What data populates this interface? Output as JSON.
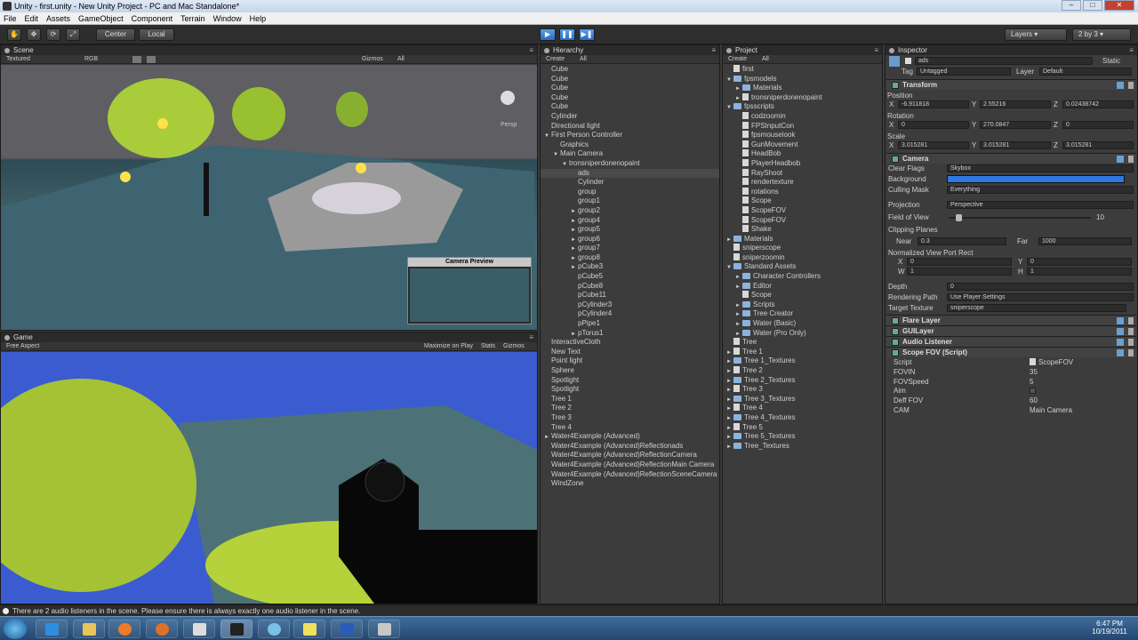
{
  "window": {
    "title": "Unity - first.unity - New Unity Project - PC and Mac Standalone*"
  },
  "menu": [
    "File",
    "Edit",
    "Assets",
    "GameObject",
    "Component",
    "Terrain",
    "Window",
    "Help"
  ],
  "toolbar": {
    "center": "Center",
    "local": "Local",
    "layers": "Layers",
    "layout": "2 by 3"
  },
  "scene": {
    "tab": "Scene",
    "render_mode": "Textured",
    "color_mode": "RGB",
    "gizmos": "Gizmos",
    "search": "All",
    "persp": "Persp",
    "camera_preview": "Camera Preview"
  },
  "game": {
    "tab": "Game",
    "aspect": "Free Aspect",
    "maximize": "Maximize on Play",
    "stats": "Stats",
    "gizmos": "Gizmos"
  },
  "hierarchy": {
    "tab": "Hierarchy",
    "create": "Create",
    "search": "All",
    "items": [
      {
        "label": "Cube",
        "indent": 0,
        "arrow": ""
      },
      {
        "label": "Cube",
        "indent": 0,
        "arrow": ""
      },
      {
        "label": "Cube",
        "indent": 0,
        "arrow": ""
      },
      {
        "label": "Cube",
        "indent": 0,
        "arrow": ""
      },
      {
        "label": "Cube",
        "indent": 0,
        "arrow": ""
      },
      {
        "label": "Cylinder",
        "indent": 0,
        "arrow": ""
      },
      {
        "label": "Directional light",
        "indent": 0,
        "arrow": ""
      },
      {
        "label": "First Person Controller",
        "indent": 0,
        "arrow": "▼"
      },
      {
        "label": "Graphics",
        "indent": 1,
        "arrow": ""
      },
      {
        "label": "Main Camera",
        "indent": 1,
        "arrow": "▼"
      },
      {
        "label": "tronsniperdonenopaint",
        "indent": 2,
        "arrow": "▼"
      },
      {
        "label": "ads",
        "indent": 3,
        "arrow": "",
        "sel": true
      },
      {
        "label": "Cylinder",
        "indent": 3,
        "arrow": ""
      },
      {
        "label": "group",
        "indent": 3,
        "arrow": ""
      },
      {
        "label": "group1",
        "indent": 3,
        "arrow": ""
      },
      {
        "label": "group2",
        "indent": 3,
        "arrow": "►"
      },
      {
        "label": "group4",
        "indent": 3,
        "arrow": "►"
      },
      {
        "label": "group5",
        "indent": 3,
        "arrow": "►"
      },
      {
        "label": "group6",
        "indent": 3,
        "arrow": "►"
      },
      {
        "label": "group7",
        "indent": 3,
        "arrow": "►"
      },
      {
        "label": "group8",
        "indent": 3,
        "arrow": "►"
      },
      {
        "label": "pCube3",
        "indent": 3,
        "arrow": "►"
      },
      {
        "label": "pCube5",
        "indent": 3,
        "arrow": ""
      },
      {
        "label": "pCube8",
        "indent": 3,
        "arrow": ""
      },
      {
        "label": "pCube11",
        "indent": 3,
        "arrow": ""
      },
      {
        "label": "pCylinder3",
        "indent": 3,
        "arrow": ""
      },
      {
        "label": "pCylinder4",
        "indent": 3,
        "arrow": ""
      },
      {
        "label": "pPipe1",
        "indent": 3,
        "arrow": ""
      },
      {
        "label": "pTorus1",
        "indent": 3,
        "arrow": "►"
      },
      {
        "label": "InteractiveCloth",
        "indent": 0,
        "arrow": ""
      },
      {
        "label": "New Text",
        "indent": 0,
        "arrow": ""
      },
      {
        "label": "Point light",
        "indent": 0,
        "arrow": ""
      },
      {
        "label": "Sphere",
        "indent": 0,
        "arrow": ""
      },
      {
        "label": "Spotlight",
        "indent": 0,
        "arrow": ""
      },
      {
        "label": "Spotlight",
        "indent": 0,
        "arrow": ""
      },
      {
        "label": "Tree 1",
        "indent": 0,
        "arrow": ""
      },
      {
        "label": "Tree 2",
        "indent": 0,
        "arrow": ""
      },
      {
        "label": "Tree 3",
        "indent": 0,
        "arrow": ""
      },
      {
        "label": "Tree 4",
        "indent": 0,
        "arrow": ""
      },
      {
        "label": "Water4Example (Advanced)",
        "indent": 0,
        "arrow": "►"
      },
      {
        "label": "Water4Example (Advanced)Reflectionads",
        "indent": 0,
        "arrow": ""
      },
      {
        "label": "Water4Example (Advanced)ReflectionCamera",
        "indent": 0,
        "arrow": ""
      },
      {
        "label": "Water4Example (Advanced)ReflectionMain Camera",
        "indent": 0,
        "arrow": ""
      },
      {
        "label": "Water4Example (Advanced)ReflectionSceneCamera",
        "indent": 0,
        "arrow": ""
      },
      {
        "label": "WindZone",
        "indent": 0,
        "arrow": ""
      }
    ]
  },
  "project": {
    "tab": "Project",
    "create": "Create",
    "search": "All",
    "items": [
      {
        "label": "first",
        "indent": 0,
        "arrow": "",
        "type": "file"
      },
      {
        "label": "fpsmodels",
        "indent": 0,
        "arrow": "▼",
        "type": "folder"
      },
      {
        "label": "Materials",
        "indent": 1,
        "arrow": "►",
        "type": "folder"
      },
      {
        "label": "tronsniperdonenopaint",
        "indent": 1,
        "arrow": "►",
        "type": "file"
      },
      {
        "label": "fpsscripts",
        "indent": 0,
        "arrow": "▼",
        "type": "folder"
      },
      {
        "label": "codzoomin",
        "indent": 1,
        "arrow": "",
        "type": "file"
      },
      {
        "label": "FPSInputCon",
        "indent": 1,
        "arrow": "",
        "type": "file"
      },
      {
        "label": "fpsmouselook",
        "indent": 1,
        "arrow": "",
        "type": "file"
      },
      {
        "label": "GunMovement",
        "indent": 1,
        "arrow": "",
        "type": "file"
      },
      {
        "label": "HeadBob",
        "indent": 1,
        "arrow": "",
        "type": "file"
      },
      {
        "label": "PlayerHeadbob",
        "indent": 1,
        "arrow": "",
        "type": "file"
      },
      {
        "label": "RayShoot",
        "indent": 1,
        "arrow": "",
        "type": "file"
      },
      {
        "label": "rendertexture",
        "indent": 1,
        "arrow": "",
        "type": "file"
      },
      {
        "label": "rotations",
        "indent": 1,
        "arrow": "",
        "type": "file"
      },
      {
        "label": "Scope",
        "indent": 1,
        "arrow": "",
        "type": "file"
      },
      {
        "label": "ScopeFOV",
        "indent": 1,
        "arrow": "",
        "type": "file"
      },
      {
        "label": "ScopeFOV",
        "indent": 1,
        "arrow": "",
        "type": "file"
      },
      {
        "label": "Shake",
        "indent": 1,
        "arrow": "",
        "type": "file"
      },
      {
        "label": "Materials",
        "indent": 0,
        "arrow": "►",
        "type": "folder"
      },
      {
        "label": "sniperscope",
        "indent": 0,
        "arrow": "",
        "type": "file"
      },
      {
        "label": "sniperzoomin",
        "indent": 0,
        "arrow": "",
        "type": "file"
      },
      {
        "label": "Standard Assets",
        "indent": 0,
        "arrow": "▼",
        "type": "folder"
      },
      {
        "label": "Character Controllers",
        "indent": 1,
        "arrow": "►",
        "type": "folder"
      },
      {
        "label": "Editor",
        "indent": 1,
        "arrow": "►",
        "type": "folder"
      },
      {
        "label": "Scope",
        "indent": 1,
        "arrow": "",
        "type": "file"
      },
      {
        "label": "Scripts",
        "indent": 1,
        "arrow": "►",
        "type": "folder"
      },
      {
        "label": "Tree Creator",
        "indent": 1,
        "arrow": "►",
        "type": "folder"
      },
      {
        "label": "Water (Basic)",
        "indent": 1,
        "arrow": "►",
        "type": "folder"
      },
      {
        "label": "Water (Pro Only)",
        "indent": 1,
        "arrow": "►",
        "type": "folder"
      },
      {
        "label": "Tree",
        "indent": 0,
        "arrow": "",
        "type": "file"
      },
      {
        "label": "Tree 1",
        "indent": 0,
        "arrow": "►",
        "type": "file"
      },
      {
        "label": "Tree 1_Textures",
        "indent": 0,
        "arrow": "►",
        "type": "folder"
      },
      {
        "label": "Tree 2",
        "indent": 0,
        "arrow": "►",
        "type": "file"
      },
      {
        "label": "Tree 2_Textures",
        "indent": 0,
        "arrow": "►",
        "type": "folder"
      },
      {
        "label": "Tree 3",
        "indent": 0,
        "arrow": "►",
        "type": "file"
      },
      {
        "label": "Tree 3_Textures",
        "indent": 0,
        "arrow": "►",
        "type": "folder"
      },
      {
        "label": "Tree 4",
        "indent": 0,
        "arrow": "►",
        "type": "file"
      },
      {
        "label": "Tree 4_Textures",
        "indent": 0,
        "arrow": "►",
        "type": "folder"
      },
      {
        "label": "Tree 5",
        "indent": 0,
        "arrow": "►",
        "type": "file"
      },
      {
        "label": "Tree 5_Textures",
        "indent": 0,
        "arrow": "►",
        "type": "folder"
      },
      {
        "label": "Tree_Textures",
        "indent": 0,
        "arrow": "►",
        "type": "folder"
      }
    ]
  },
  "inspector": {
    "tab": "Inspector",
    "object_name": "ads",
    "static": "Static",
    "tag_label": "Tag",
    "tag": "Untagged",
    "layer_label": "Layer",
    "layer": "Default",
    "transform": {
      "title": "Transform",
      "position_label": "Position",
      "rotation_label": "Rotation",
      "scale_label": "Scale",
      "pos": {
        "x": "-6.911818",
        "y": "2.55216",
        "z": "0.02438742"
      },
      "rot": {
        "x": "0",
        "y": "270.0847",
        "z": "0"
      },
      "scale": {
        "x": "3.015281",
        "y": "3.015281",
        "z": "3.015281"
      },
      "x": "X",
      "y": "Y",
      "z": "Z"
    },
    "camera": {
      "title": "Camera",
      "clear_flags_label": "Clear Flags",
      "clear_flags": "Skybox",
      "background_label": "Background",
      "culling_label": "Culling Mask",
      "culling": "Everything",
      "projection_label": "Projection",
      "projection": "Perspective",
      "fov_label": "Field of View",
      "fov": "10",
      "fov_slider": 0.05,
      "clipping_label": "Clipping Planes",
      "near_label": "Near",
      "near": "0.3",
      "far_label": "Far",
      "far": "1000",
      "viewport_label": "Normalized View Port Rect",
      "vx": "0",
      "vy": "0",
      "vw": "1",
      "vh": "1",
      "x": "X",
      "y": "Y",
      "w": "W",
      "h": "H",
      "depth_label": "Depth",
      "depth": "0",
      "rendering_label": "Rendering Path",
      "rendering": "Use Player Settings",
      "target_label": "Target Texture",
      "target": "sniperscope",
      "bg_color": "#2f78e0"
    },
    "components": [
      "Flare Layer",
      "GUILayer",
      "Audio Listener",
      "Scope FOV (Script)"
    ],
    "script": {
      "script_label": "Script",
      "script": "ScopeFOV",
      "fovin_label": "FOVIN",
      "fovin": "35",
      "fovspeed_label": "FOVSpeed",
      "fovspeed": "5",
      "aim_label": "Aim",
      "deff_label": "Deff FOV",
      "deff": "60",
      "cam_label": "CAM",
      "cam": "Main Camera"
    }
  },
  "status": {
    "message": "There are 2 audio listeners in the scene. Please ensure there is always exactly one audio listener in the scene."
  },
  "taskbar": {
    "time": "6:47 PM",
    "date": "10/19/2011"
  }
}
